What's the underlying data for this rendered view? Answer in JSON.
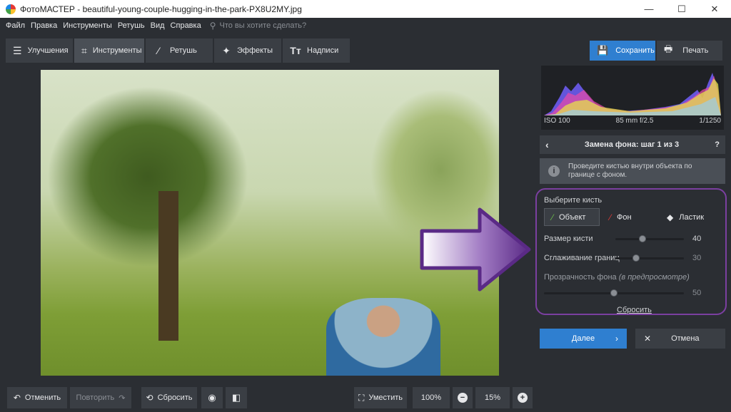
{
  "window": {
    "title": "ФотоМАСТЕР - beautiful-young-couple-hugging-in-the-park-PX8U2MY.jpg",
    "minimize": "—",
    "maximize": "☐",
    "close": "✕"
  },
  "menu": {
    "items": [
      "Файл",
      "Правка",
      "Инструменты",
      "Ретушь",
      "Вид",
      "Справка"
    ],
    "search_placeholder": "Что вы хотите сделать?"
  },
  "tabs": [
    {
      "label": "Улучшения",
      "icon": "sliders-icon"
    },
    {
      "label": "Инструменты",
      "icon": "crop-icon",
      "active": true
    },
    {
      "label": "Ретушь",
      "icon": "brush-icon"
    },
    {
      "label": "Эффекты",
      "icon": "magic-wand-icon"
    },
    {
      "label": "Надписи",
      "icon": "text-icon"
    }
  ],
  "actions": {
    "save_label": "Сохранить",
    "print_label": "Печать"
  },
  "histogram": {
    "iso": "ISO 100",
    "lens": "85 mm f/2.5",
    "shutter": "1/1250"
  },
  "step": {
    "title": "Замена фона: шаг 1 из 3",
    "help": "?"
  },
  "info": {
    "text_line1": "Проведите кистью внутри объекта по",
    "text_line2": "границе с фоном."
  },
  "brush": {
    "label": "Выберите кисть",
    "options": [
      {
        "label": "Объект",
        "active": true
      },
      {
        "label": "Фон",
        "active": false
      },
      {
        "label": "Ластик",
        "active": false
      }
    ]
  },
  "sliders": {
    "size": {
      "label": "Размер кисти",
      "value": "40",
      "fraction": 0.4
    },
    "smooth": {
      "label": "Сглаживание границ",
      "value": "30",
      "fraction": 0.3
    },
    "opacity": {
      "label": "Прозрачность фона",
      "hint": "(в предпросмотре)",
      "value": "50",
      "fraction": 0.5
    }
  },
  "reset_link": "Сбросить",
  "nav": {
    "next_label": "Далее",
    "cancel_label": "Отмена"
  },
  "bottom": {
    "undo_label": "Отменить",
    "redo_label": "Повторить",
    "reset_label": "Сбросить",
    "fit_label": "Уместить",
    "zoom_100": "100%",
    "zoom_value": "15%"
  },
  "colors": {
    "accent_blue": "#2f7fd0",
    "highlight_purple": "#7b3fa0",
    "background": "#2b2e33"
  }
}
